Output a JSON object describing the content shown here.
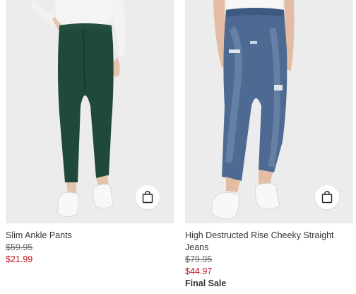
{
  "products": [
    {
      "name": "Slim Ankle Pants",
      "original_price": "$59.95",
      "sale_price": "$21.99",
      "bag_icon": "shopping-bag-icon"
    },
    {
      "name": "High Destructed Rise Cheeky Straight Jeans",
      "original_price": "$79.95",
      "sale_price": "$44.97",
      "final_sale": "Final Sale",
      "bag_icon": "shopping-bag-icon"
    }
  ],
  "colors": {
    "sale_price": "#c4121a",
    "text": "#333333",
    "photo_background": "#ededed"
  }
}
